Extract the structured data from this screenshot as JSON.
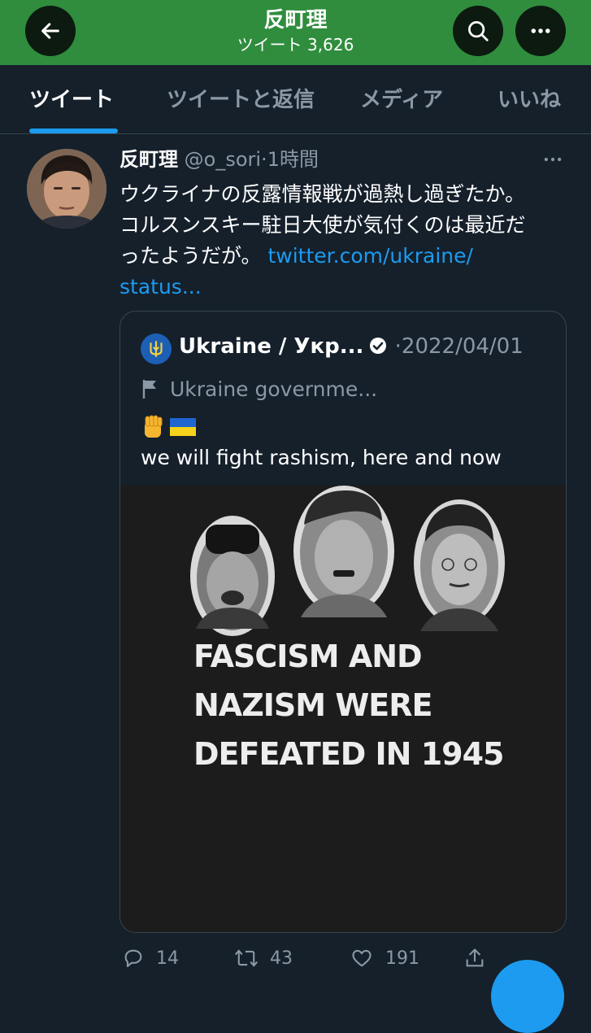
{
  "header": {
    "title": "反町理",
    "subtitle": "ツイート 3,626",
    "back_icon": "arrow-left-icon",
    "search_icon": "search-icon",
    "more_icon": "more-horizontal-icon",
    "bg_color": "#2f8d3d"
  },
  "tabs": [
    {
      "label": "ツイート",
      "active": true
    },
    {
      "label": "ツイートと返信",
      "active": false
    },
    {
      "label": "メディア",
      "active": false
    },
    {
      "label": "いいね",
      "active": false
    }
  ],
  "tweet": {
    "name": "反町理",
    "handle": "@o_sori",
    "separator": "·",
    "time": "1時間",
    "text_line1": "ウクライナの反露情報戦が過熱し過ぎたか。",
    "text_line2": "コルスンスキー駐日大使が気付くのは最近だ",
    "text_line3": "ったようだが。",
    "link_part1": "twitter.com/ukraine/",
    "link_part2": "status...",
    "accent_color": "#1d9bf0"
  },
  "quote": {
    "name": "Ukraine / Укр...",
    "separator": "·",
    "date": "2022/04/01",
    "label": "Ukraine governme...",
    "emoji": [
      "✊",
      "🇺🇦"
    ],
    "text": "we will fight rashism, here and now",
    "media": {
      "line1": "FASCISM AND",
      "line2": "NAZISM WERE",
      "line3": "DEFEATED IN 1945"
    }
  },
  "actions": {
    "reply_count": "14",
    "retweet_count": "43",
    "like_count": "191"
  }
}
